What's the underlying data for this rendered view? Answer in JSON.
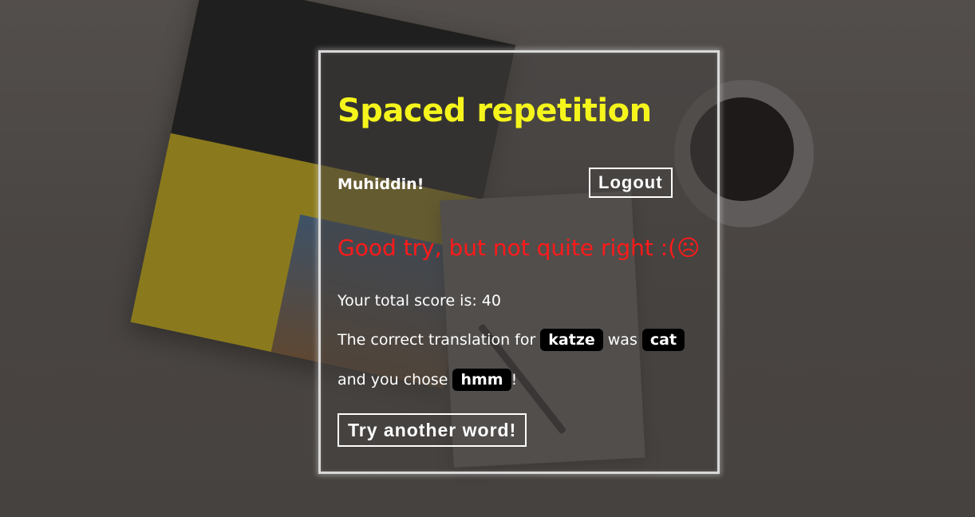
{
  "header": {
    "title": "Spaced repetition",
    "username": "Muhiddin!",
    "logout_label": "Logout"
  },
  "feedback": {
    "message": "Good try, but not quite right :(",
    "emoji": "☹",
    "score_label": "Your total score is: 40",
    "translation_prefix": "The correct translation for",
    "original_word": "katze",
    "translation_middle": "was",
    "correct_translation": "cat",
    "guess_prefix": "and you chose",
    "user_guess": "hmm",
    "guess_suffix": "!",
    "next_button_label": "Try another word!"
  },
  "colors": {
    "title": "#f5f51c",
    "feedback": "#ff1a1a",
    "tag_bg": "#000000",
    "text": "#ffffff"
  },
  "icons": {
    "feedback_emoji": "frowning-face-icon"
  }
}
